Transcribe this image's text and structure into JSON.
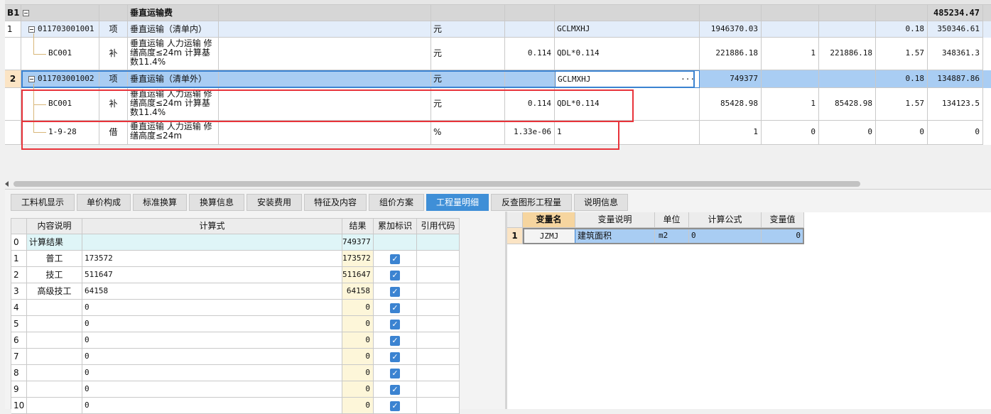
{
  "top_grid": {
    "rows": [
      {
        "idx": "B1",
        "code": "",
        "type": "",
        "name": "垂直运输费",
        "unit": "",
        "qty": "",
        "expr": "",
        "v1": "",
        "v2": "",
        "v3": "",
        "v4": "",
        "total": "485234.47"
      },
      {
        "idx": "1",
        "code": "011703001001",
        "type": "项",
        "name": "垂直运输（清单内）",
        "unit": "元",
        "qty": "",
        "expr": "GCLMXHJ",
        "v1": "1946370.03",
        "v2": "",
        "v3": "",
        "v4": "0.18",
        "total": "350346.61"
      },
      {
        "idx": "",
        "code": "BC001",
        "type": "补",
        "name": "垂直运输 人力运输 修缮高度≤24m 计算基数11.4%",
        "unit": "元",
        "qty": "0.114",
        "expr": "QDL*0.114",
        "v1": "221886.18",
        "v2": "1",
        "v3": "221886.18",
        "v4": "1.57",
        "total": "348361.3"
      },
      {
        "idx": "2",
        "code": "011703001002",
        "type": "项",
        "name": "垂直运输（清单外）",
        "unit": "元",
        "qty": "",
        "expr": "GCLMXHJ",
        "expr_btn": "···",
        "v1": "749377",
        "v2": "",
        "v3": "",
        "v4": "0.18",
        "total": "134887.86"
      },
      {
        "idx": "",
        "code": "BC001",
        "type": "补",
        "name": "垂直运输 人力运输 修缮高度≤24m 计算基数11.4%",
        "unit": "元",
        "qty": "0.114",
        "expr": "QDL*0.114",
        "v1": "85428.98",
        "v2": "1",
        "v3": "85428.98",
        "v4": "1.57",
        "total": "134123.5"
      },
      {
        "idx": "",
        "code": "1-9-28",
        "type": "借",
        "name": "垂直运输 人力运输 修缮高度≤24m",
        "unit": "%",
        "qty": "1.33e-06",
        "expr": "1",
        "v1": "1",
        "v2": "0",
        "v3": "0",
        "v4": "0",
        "total": "0"
      }
    ]
  },
  "tabs": [
    "工料机显示",
    "单价构成",
    "标准换算",
    "换算信息",
    "安装费用",
    "特征及内容",
    "组价方案",
    "工程量明细",
    "反查图形工程量",
    "说明信息"
  ],
  "active_tab": "工程量明细",
  "detail_grid": {
    "headers": {
      "desc": "内容说明",
      "formula": "计算式",
      "result": "结果",
      "accum": "累加标识",
      "ref": "引用代码"
    },
    "rows": [
      {
        "idx": "0",
        "desc": "计算结果",
        "formula": "",
        "result": "749377",
        "checked": false
      },
      {
        "idx": "1",
        "desc": "普工",
        "formula": "173572",
        "result": "173572",
        "checked": true
      },
      {
        "idx": "2",
        "desc": "技工",
        "formula": "511647",
        "result": "511647",
        "checked": true
      },
      {
        "idx": "3",
        "desc": "高级技工",
        "formula": "64158",
        "result": "64158",
        "checked": true
      },
      {
        "idx": "4",
        "desc": "",
        "formula": "0",
        "result": "0",
        "checked": true
      },
      {
        "idx": "5",
        "desc": "",
        "formula": "0",
        "result": "0",
        "checked": true
      },
      {
        "idx": "6",
        "desc": "",
        "formula": "0",
        "result": "0",
        "checked": true
      },
      {
        "idx": "7",
        "desc": "",
        "formula": "0",
        "result": "0",
        "checked": true
      },
      {
        "idx": "8",
        "desc": "",
        "formula": "0",
        "result": "0",
        "checked": true
      },
      {
        "idx": "9",
        "desc": "",
        "formula": "0",
        "result": "0",
        "checked": true
      },
      {
        "idx": "10",
        "desc": "",
        "formula": "0",
        "result": "0",
        "checked": true
      }
    ]
  },
  "var_grid": {
    "headers": {
      "name": "变量名",
      "desc": "变量说明",
      "unit": "单位",
      "formula": "计算公式",
      "value": "变量值"
    },
    "rows": [
      {
        "idx": "1",
        "name": "JZMJ",
        "desc": "建筑面积",
        "unit": "m2",
        "formula": "0",
        "value": "0"
      }
    ]
  },
  "icons": {
    "check": "check-icon",
    "collapse": "collapse-box-icon",
    "scroll_left": "scroll-left-icon"
  }
}
